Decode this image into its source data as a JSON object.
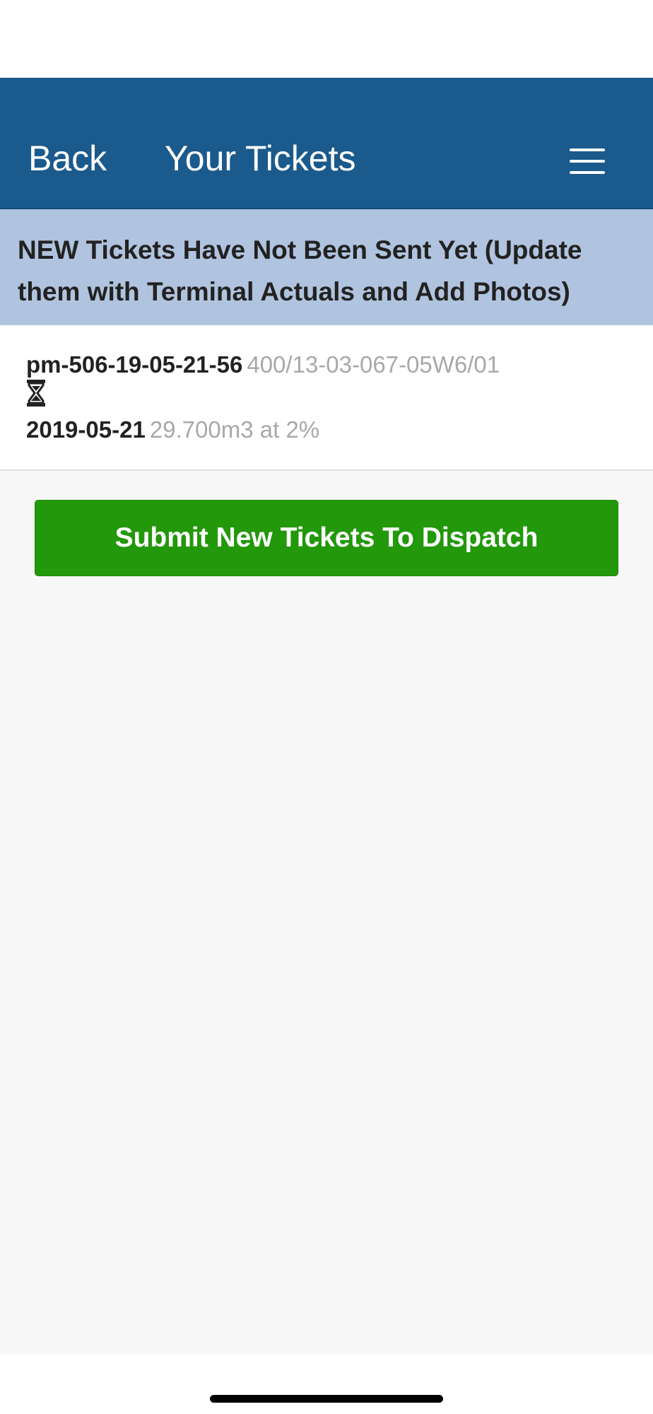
{
  "navbar": {
    "back_label": "Back",
    "title": "Your Tickets",
    "menu_icon": "hamburger-menu-icon",
    "background_color": "#1b5a8c"
  },
  "notice": {
    "text": "NEW Tickets Have Not Been Sent Yet (Update them with Terminal Actuals and Add Photos)",
    "background_color": "#b0c4df"
  },
  "tickets": [
    {
      "id": "pm-506-19-05-21-56",
      "location": "400/13-03-067-05W6/01",
      "status_icon": "hourglass-icon",
      "date": "2019-05-21",
      "volume": "29.700m3 at 2%"
    }
  ],
  "actions": {
    "submit_label": "Submit New Tickets To Dispatch",
    "submit_color": "#22980a"
  }
}
